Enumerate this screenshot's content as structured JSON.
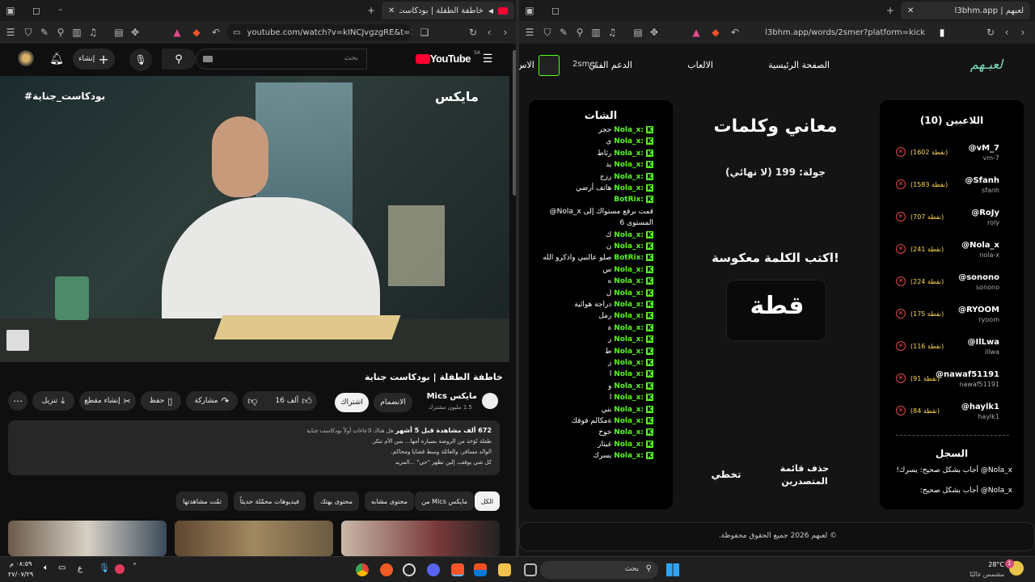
{
  "left_window": {
    "tab_title": "خاطفة الطفلة | بودكاست جناية",
    "url": "youtube.com/watch?v=kINCJvgzgRE&t=1...",
    "yt": {
      "logo": "YouTube",
      "region": "SA",
      "search_placeholder": "بحث",
      "create_label": "إنشاء",
      "video": {
        "overlay_hashtag": "#بودكاست_جناية",
        "overlay_brand": "مايكس",
        "title": "خاطفة الطفلة | بودكاست جناية",
        "channel": "مايكس Mics",
        "subscribers": "1.5 مليون مشترك",
        "join_label": "الانضمام",
        "subscribe_label": "اشتراك",
        "likes": "16 ألف",
        "share_label": "مشاركة",
        "save_label": "حفظ",
        "clip_label": "إنشاء مقطع",
        "download_label": "تنزيل"
      },
      "description": {
        "stats": "672 ألف مشاهدة  قبل 5 أشهر",
        "line0": "هل هناك ادّعاءات أولاً  بودكاست جناية",
        "line1": "طفلة تُؤخذ من الروضة بسيارة أمها... بس الأم تنكر.",
        "line2": "الوالد مسافر، والعائلة وسط قضايا ومحاكم.",
        "line3": "كل شي يوقف، إلين تظهر \"حي\" ...المزيد"
      },
      "chips": [
        "الكل",
        "من Mics مايكس",
        "محتوى مشابه",
        "محتوى بهتك",
        "فيديوهات محمّلة حديثاً",
        "تمّت مشاهدتها"
      ]
    }
  },
  "right_window": {
    "tab_title": "l3bhm.app | لعبهم",
    "url": "l3bhm.app/words/2smer?platform=kick",
    "nav": {
      "logo": "لعبـهم",
      "home": "الصفحة الرئيسية",
      "games": "الالعاب",
      "support": "الدعم الفني",
      "username": "2smer",
      "trailing": "الاس"
    },
    "players_title": "اللاعبين (10)",
    "players": [
      {
        "name": "@vM_7",
        "sub": "vm-7",
        "points": "(1602 نقطة)"
      },
      {
        "name": "@Sfanh",
        "sub": "sfanh",
        "points": "(1583 نقطة)"
      },
      {
        "name": "@RoJy",
        "sub": "roly",
        "points": "(707 نقطة)"
      },
      {
        "name": "@Nola_x",
        "sub": "nola-x",
        "points": "(241 نقطة)"
      },
      {
        "name": "@sonono",
        "sub": "sonono",
        "points": "(224 نقطة)"
      },
      {
        "name": "@RYOOM",
        "sub": "ryoom",
        "points": "(175 نقطة)"
      },
      {
        "name": "@IlLwa",
        "sub": "illwa",
        "points": "(116 نقطة)"
      },
      {
        "name": "@nawaf51191",
        "sub": "nawaf51191",
        "points": "(91 نقطة)"
      },
      {
        "name": "@haylk1",
        "sub": "haylk1",
        "points": "(84 نقطة)"
      }
    ],
    "log_title": "السجل",
    "log": [
      "Nola_x@ أجاب بشكل صحيح: يسرك!",
      "Nola_x@ أجاب بشكل صحيح:"
    ],
    "game_title": "معاني وكلمات",
    "round": "جولة: 199 (لا نهائي)",
    "instruction": "اكتب الكلمة معكوسة!",
    "word": "قطة",
    "delete_board": "حذف قائمة المتصدرين",
    "skip": "تخطي",
    "chat_title": "الشات",
    "chat": [
      {
        "user": "Nola_x:",
        "msg": "حجر"
      },
      {
        "user": "Nola_x:",
        "msg": "ي"
      },
      {
        "user": "Nola_x:",
        "msg": "رثاط"
      },
      {
        "user": "Nola_x:",
        "msg": "يد"
      },
      {
        "user": "Nola_x:",
        "msg": "رزج"
      },
      {
        "user": "Nola_x:",
        "msg": "هاتف أرضي"
      },
      {
        "user": "BotRix:",
        "msg": ""
      },
      {
        "user": "",
        "msg": "@Nola_x قمت برفع مستواك إلى"
      },
      {
        "user": "",
        "msg": "المستوى 6"
      },
      {
        "user": "Nola_x:",
        "msg": "ك"
      },
      {
        "user": "Nola_x:",
        "msg": "ن"
      },
      {
        "user": "BotRix:",
        "msg": "صلو عالنبي واذكرو الله"
      },
      {
        "user": "Nola_x:",
        "msg": "س"
      },
      {
        "user": "Nola_x:",
        "msg": "ه"
      },
      {
        "user": "Nola_x:",
        "msg": "ل"
      },
      {
        "user": "Nola_x:",
        "msg": "دراجة هوائية"
      },
      {
        "user": "Nola_x:",
        "msg": "رمل"
      },
      {
        "user": "Nola_x:",
        "msg": "ة"
      },
      {
        "user": "Nola_x:",
        "msg": "ر"
      },
      {
        "user": "Nola_x:",
        "msg": "ط"
      },
      {
        "user": "Nola_x:",
        "msg": "ز"
      },
      {
        "user": "Nola_x:",
        "msg": "ا"
      },
      {
        "user": "Nola_x:",
        "msg": "و"
      },
      {
        "user": "Nola_x:",
        "msg": "ا"
      },
      {
        "user": "Nola_x:",
        "msg": "بني"
      },
      {
        "user": "Nola_x:",
        "msg": "ةمكالم فوقك"
      },
      {
        "user": "Nola_x:",
        "msg": "خوخ"
      },
      {
        "user": "Nola_x:",
        "msg": "غيتار"
      },
      {
        "user": "Nola_x:",
        "msg": "يسرك"
      }
    ],
    "footer": "© لعبهم 2026 جميع الحقوق محفوظة."
  },
  "taskbar": {
    "weather_temp": "28°C",
    "weather_desc": "مشمس غالبًا",
    "search_placeholder": "بحث",
    "time": "٠٨:٥٩ م",
    "date": "٢٧/٠٧/٢٩",
    "lang": "ع",
    "notif_count": "1"
  },
  "colors": {
    "kick_green": "#53fc18",
    "points_yellow": "#ffd84d",
    "delete_red": "#e04848",
    "yt_red": "#ff0033"
  }
}
